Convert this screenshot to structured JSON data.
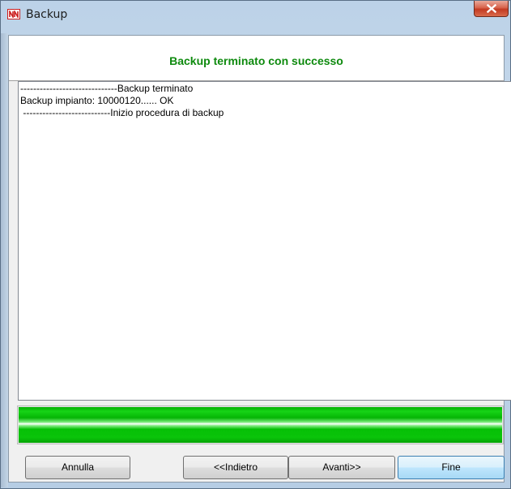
{
  "window": {
    "title": "Backup",
    "close_icon": "close-icon",
    "app_icon": "nn-logo-icon"
  },
  "header": {
    "status": "Backup terminato con successo",
    "color": "#0e8a0e"
  },
  "log": {
    "lines": [
      "------------------------------Backup terminato",
      "Backup impianto: 10000120...... OK",
      " ---------------------------Inizio procedura di backup"
    ]
  },
  "progress": {
    "fraction": 1.0,
    "color": "#06c006"
  },
  "buttons": {
    "cancel": "Annulla",
    "back": "<<Indietro",
    "next": "Avanti>>",
    "finish": "Fine"
  }
}
